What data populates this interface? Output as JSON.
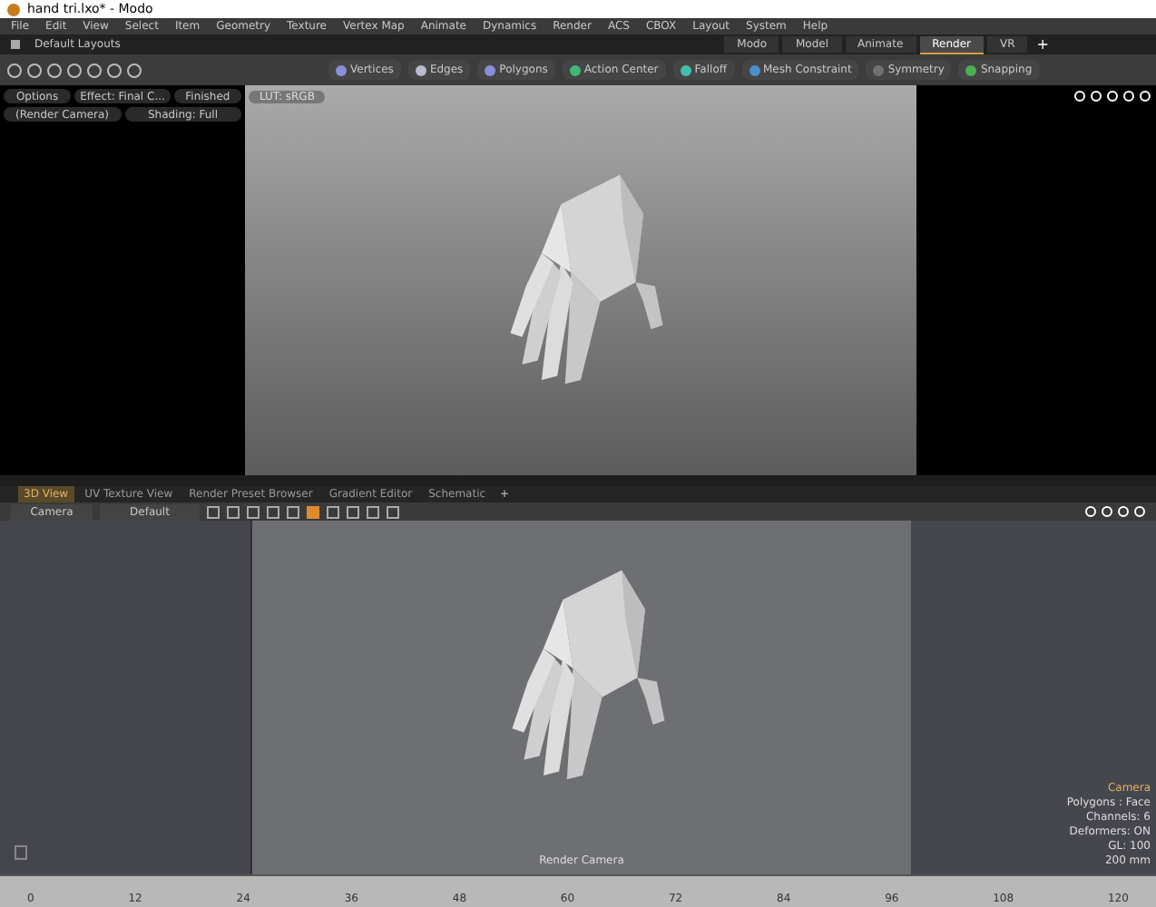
{
  "window": {
    "title": "hand tri.lxo* - Modo"
  },
  "menu": [
    "File",
    "Edit",
    "View",
    "Select",
    "Item",
    "Geometry",
    "Texture",
    "Vertex Map",
    "Animate",
    "Dynamics",
    "Render",
    "ACS",
    "CBOX",
    "Layout",
    "System",
    "Help"
  ],
  "layouts": {
    "label": "Default Layouts",
    "tabs": [
      {
        "label": "Modo",
        "selected": false
      },
      {
        "label": "Model",
        "selected": false
      },
      {
        "label": "Animate",
        "selected": false
      },
      {
        "label": "Render",
        "selected": true
      },
      {
        "label": "VR",
        "selected": false
      }
    ],
    "add": "+"
  },
  "toolbar": [
    {
      "label": "Vertices",
      "color": "#8a8fd8"
    },
    {
      "label": "Edges",
      "color": "#b8bccc"
    },
    {
      "label": "Polygons",
      "color": "#8a8fd8"
    },
    {
      "label": "Action Center",
      "color": "#3fb87a"
    },
    {
      "label": "Falloff",
      "color": "#3fc0b0"
    },
    {
      "label": "Mesh Constraint",
      "color": "#4a90c8"
    },
    {
      "label": "Symmetry",
      "color": "#707070"
    },
    {
      "label": "Snapping",
      "color": "#4caf50"
    }
  ],
  "render_panel": {
    "row_1": [
      "Options",
      "Effect: Final C...",
      "Finished"
    ],
    "row_2": [
      "(Render Camera)",
      "Shading: Full"
    ],
    "lut": "LUT: sRGB"
  },
  "view_tabs": [
    {
      "label": "3D View",
      "selected": true
    },
    {
      "label": "UV Texture View",
      "selected": false
    },
    {
      "label": "Render Preset Browser",
      "selected": false
    },
    {
      "label": "Gradient Editor",
      "selected": false
    },
    {
      "label": "Schematic",
      "selected": false
    }
  ],
  "view_tabs_add": "+",
  "view_toolbar": {
    "camera": "Camera",
    "style": "Default"
  },
  "viewport": {
    "label": "Render Camera"
  },
  "info": {
    "title": "Camera",
    "lines": [
      "Polygons : Face",
      "Channels: 6",
      "Deformers: ON",
      "GL: 100",
      "200 mm"
    ]
  },
  "timeline": {
    "ticks": [
      "0",
      "12",
      "24",
      "36",
      "48",
      "60",
      "72",
      "84",
      "96",
      "108",
      "120"
    ]
  }
}
